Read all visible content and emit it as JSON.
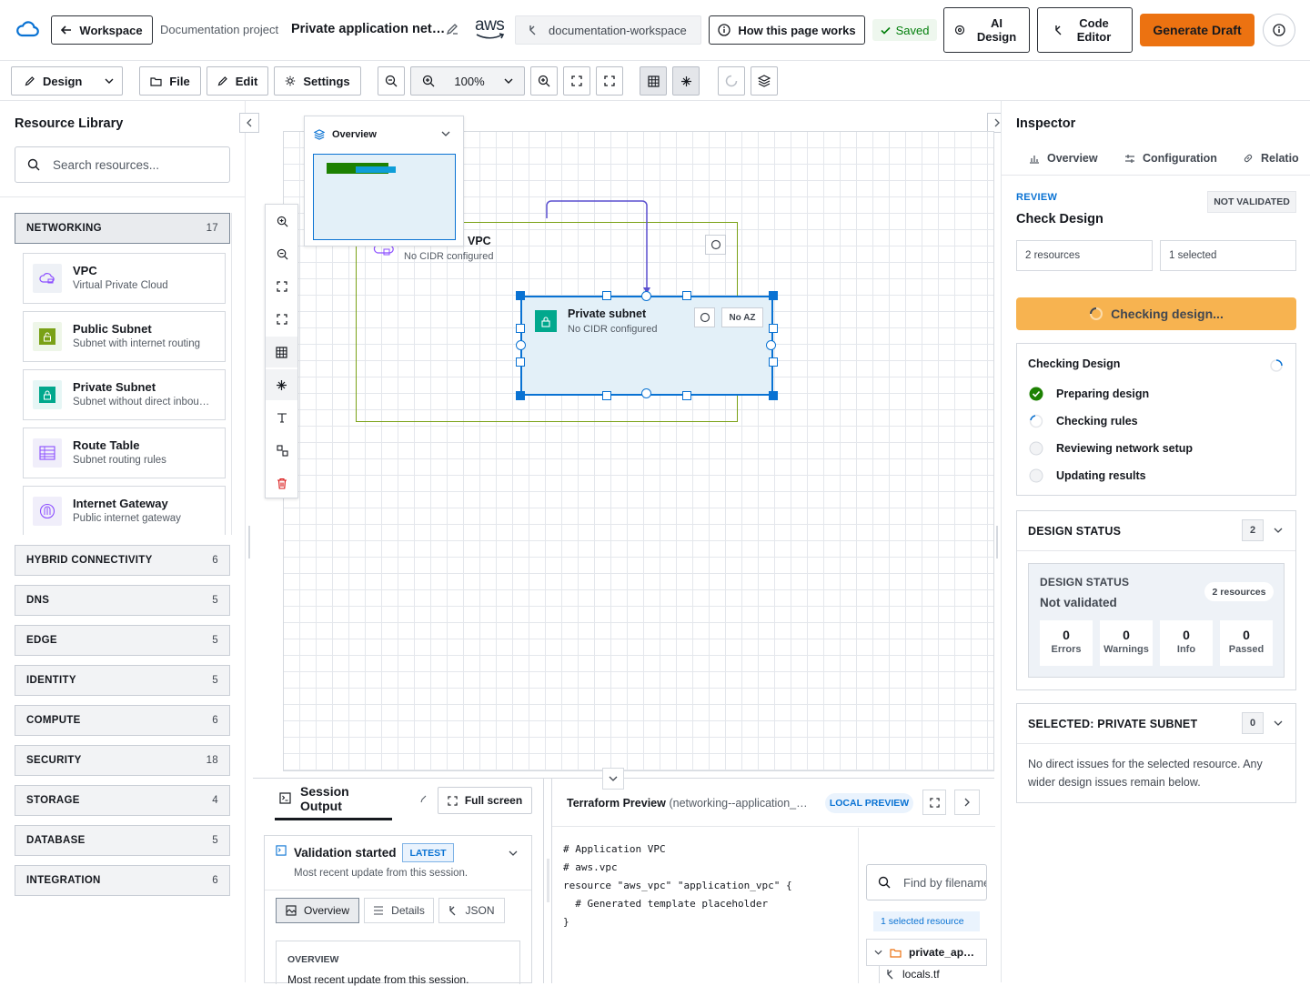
{
  "header": {
    "workspace_button": "Workspace",
    "project_name": "Documentation project",
    "page_title": "Private application net…",
    "provider_logo": "aws",
    "workspace_chip": "documentation-workspace",
    "help_button": "How this page works",
    "saved_status": "Saved",
    "ai_design_button": "AI Design",
    "code_editor_button": "Code Editor",
    "generate_button": "Generate Draft",
    "colors": {
      "accent": "#ec7211",
      "brand": "#0972d3",
      "success": "#037f0c"
    }
  },
  "toolbar": {
    "design_select": "Design",
    "file_menu": "File",
    "edit_menu": "Edit",
    "settings_menu": "Settings",
    "zoom_level": "100%"
  },
  "library": {
    "title": "Resource Library",
    "search_placeholder": "Search resources...",
    "categories": [
      {
        "name": "NETWORKING",
        "count": "17"
      },
      {
        "name": "HYBRID CONNECTIVITY",
        "count": "6"
      },
      {
        "name": "DNS",
        "count": "5"
      },
      {
        "name": "EDGE",
        "count": "5"
      },
      {
        "name": "IDENTITY",
        "count": "5"
      },
      {
        "name": "COMPUTE",
        "count": "6"
      },
      {
        "name": "SECURITY",
        "count": "18"
      },
      {
        "name": "STORAGE",
        "count": "4"
      },
      {
        "name": "DATABASE",
        "count": "5"
      },
      {
        "name": "INTEGRATION",
        "count": "6"
      }
    ],
    "resources": [
      {
        "name": "VPC",
        "desc": "Virtual Private Cloud",
        "icon": "vpc-icon"
      },
      {
        "name": "Public Subnet",
        "desc": "Subnet with internet routing",
        "icon": "public-subnet-icon"
      },
      {
        "name": "Private Subnet",
        "desc": "Subnet without direct inbou…",
        "icon": "private-subnet-icon"
      },
      {
        "name": "Route Table",
        "desc": "Subnet routing rules",
        "icon": "route-table-icon"
      },
      {
        "name": "Internet Gateway",
        "desc": "Public internet gateway",
        "icon": "internet-gateway-icon"
      }
    ]
  },
  "minimap": {
    "title": "Overview"
  },
  "canvas": {
    "vpc_title": "VPC",
    "vpc_subtitle": "No CIDR configured",
    "subnet_title": "Private subnet",
    "subnet_subtitle": "No CIDR configured",
    "subnet_az_badge": "No AZ"
  },
  "inspector": {
    "title": "Inspector",
    "tabs": [
      "Overview",
      "Configuration",
      "Relatio"
    ],
    "review_label": "REVIEW",
    "not_validated_badge": "NOT VALIDATED",
    "check_title": "Check Design",
    "resources_count": "2 resources",
    "selected_count": "1 selected",
    "checking_button": "Checking design...",
    "checking_panel_title": "Checking Design",
    "steps": [
      {
        "label": "Preparing design",
        "state": "done"
      },
      {
        "label": "Checking rules",
        "state": "running"
      },
      {
        "label": "Reviewing network setup",
        "state": "pending"
      },
      {
        "label": "Updating results",
        "state": "pending"
      }
    ],
    "design_status": {
      "header": "DESIGN STATUS",
      "count": "2",
      "inner_label": "DESIGN STATUS",
      "value": "Not validated",
      "resources_badge": "2 resources",
      "metrics": [
        {
          "value": "0",
          "label": "Errors"
        },
        {
          "value": "0",
          "label": "Warnings"
        },
        {
          "value": "0",
          "label": "Info"
        },
        {
          "value": "0",
          "label": "Passed"
        }
      ]
    },
    "selected": {
      "header": "SELECTED: PRIVATE SUBNET",
      "count": "0",
      "message": "No direct issues for the selected resource. Any wider design issues remain below."
    }
  },
  "session": {
    "tab_label": "Session Output",
    "full_screen": "Full screen",
    "event_title": "Validation started",
    "latest_badge": "LATEST",
    "event_desc": "Most recent update from this session.",
    "subtabs": [
      "Overview",
      "Details",
      "JSON"
    ],
    "overview_label": "OVERVIEW",
    "overview_text": "Most recent update from this session."
  },
  "terraform": {
    "title": "Terraform Preview",
    "subtitle": "(networking--application_…",
    "badge": "LOCAL PREVIEW",
    "code": [
      "# Application VPC",
      "# aws.vpc",
      "resource \"aws_vpc\" \"application_vpc\" {",
      "  # Generated template placeholder",
      "}"
    ],
    "find_placeholder": "Find by filename",
    "selected_resource": "1 selected resource",
    "folder": "private_ap…",
    "file": "locals.tf"
  }
}
